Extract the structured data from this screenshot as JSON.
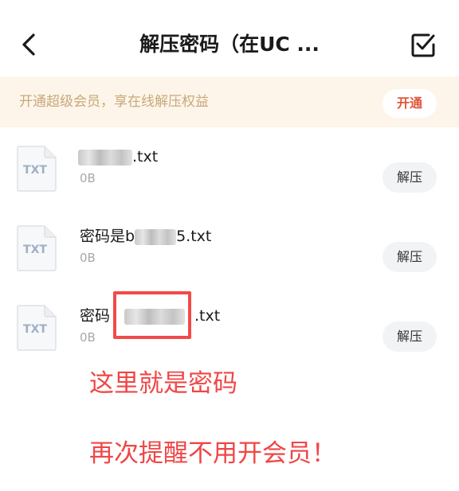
{
  "header": {
    "title": "解压密码（在UC ...",
    "back_icon": "chevron-left-icon",
    "select_icon": "checkbox-select-icon"
  },
  "banner": {
    "text": "开通超级会员，享在线解压权益",
    "button_label": "开通",
    "button_color": "#e0553c",
    "background": "#fdf5ea"
  },
  "files": [
    {
      "name_prefix": "",
      "name_suffix": ".txt",
      "size": "0B",
      "action_label": "解压",
      "icon_label": "TXT"
    },
    {
      "name_prefix": "密码是b",
      "name_suffix": "5.txt",
      "size": "0B",
      "action_label": "解压",
      "icon_label": "TXT"
    },
    {
      "name_prefix": "密码",
      "name_suffix": ".txt",
      "size": "0B",
      "action_label": "解压",
      "icon_label": "TXT"
    }
  ],
  "annotations": {
    "note1": "这里就是密码",
    "note2": "再次提醒不用开会员！",
    "color": "#f04646"
  }
}
